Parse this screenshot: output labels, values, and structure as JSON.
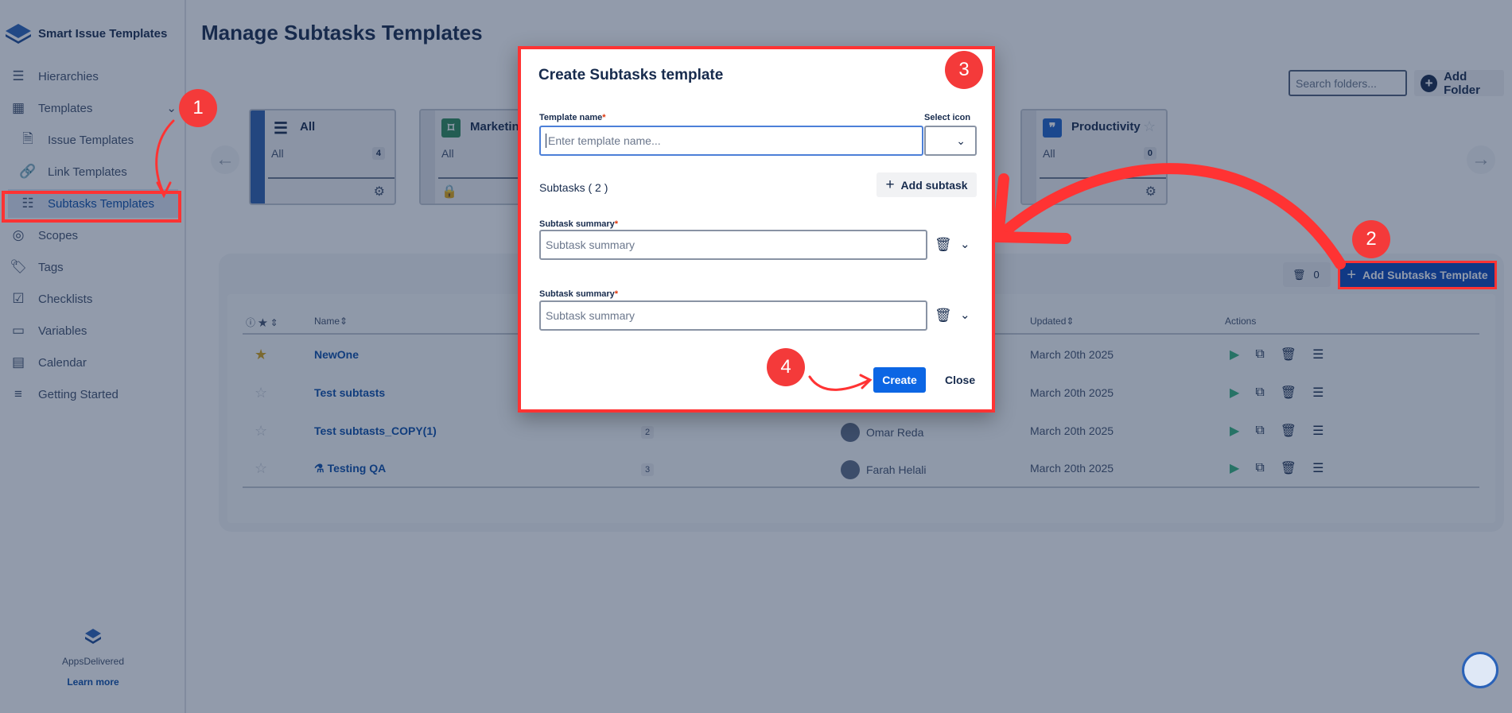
{
  "app": {
    "name": "Smart Issue Templates"
  },
  "sidebar": {
    "items": [
      {
        "label": "Hierarchies",
        "icon": "hierarchy-icon"
      },
      {
        "label": "Templates",
        "icon": "template-icon"
      },
      {
        "label": "Issue Templates",
        "icon": "document-icon"
      },
      {
        "label": "Link Templates",
        "icon": "link-icon"
      },
      {
        "label": "Subtasks Templates",
        "icon": "checklist-doc-icon",
        "active": true
      },
      {
        "label": "Scopes",
        "icon": "scope-icon"
      },
      {
        "label": "Tags",
        "icon": "tag-icon"
      },
      {
        "label": "Checklists",
        "icon": "checklist-icon"
      },
      {
        "label": "Variables",
        "icon": "variable-icon"
      },
      {
        "label": "Calendar",
        "icon": "calendar-icon"
      },
      {
        "label": "Getting Started",
        "icon": "lines-icon"
      }
    ],
    "footer": {
      "company": "AppsDelivered",
      "link": "Learn more"
    }
  },
  "page": {
    "title": "Manage Subtasks Templates",
    "search_placeholder": "Search folders...",
    "add_folder": "Add Folder"
  },
  "folders": [
    {
      "name": "All",
      "sub": "All",
      "count": "4",
      "color": "#2f5fad"
    },
    {
      "name": "Marketing",
      "sub": "All",
      "color": "#2f8a5a"
    },
    {
      "name": "Productivity",
      "sub": "All",
      "count": "0",
      "color": "#1f62c9"
    }
  ],
  "toolbar": {
    "trash_count": "0",
    "add_button": "Add Subtasks Template"
  },
  "table": {
    "headers": {
      "name": "Name",
      "updated": "Updated",
      "actions": "Actions"
    },
    "rows": [
      {
        "name": "NewOne",
        "starred": true,
        "updated": "March 20th 2025"
      },
      {
        "name": "Test subtasts",
        "starred": false,
        "updated": "March 20th 2025"
      },
      {
        "name": "Test subtasts_COPY(1)",
        "starred": false,
        "count": "2",
        "owner": "Omar Reda",
        "updated": "March 20th 2025"
      },
      {
        "name": "Testing QA",
        "starred": false,
        "count": "3",
        "owner": "Farah Helali",
        "updated": "March 20th 2025"
      }
    ]
  },
  "modal": {
    "title": "Create Subtasks template",
    "template_name_label": "Template name",
    "template_name_placeholder": "Enter template name...",
    "select_icon_label": "Select icon",
    "subtasks_label": "Subtasks ( 2 )",
    "add_subtask": "Add subtask",
    "subtask_label": "Subtask summary",
    "subtask_placeholder": "Subtask summary",
    "create": "Create",
    "close": "Close"
  },
  "annotations": {
    "steps": [
      "1",
      "2",
      "3",
      "4"
    ],
    "color": "#f43a3a"
  }
}
